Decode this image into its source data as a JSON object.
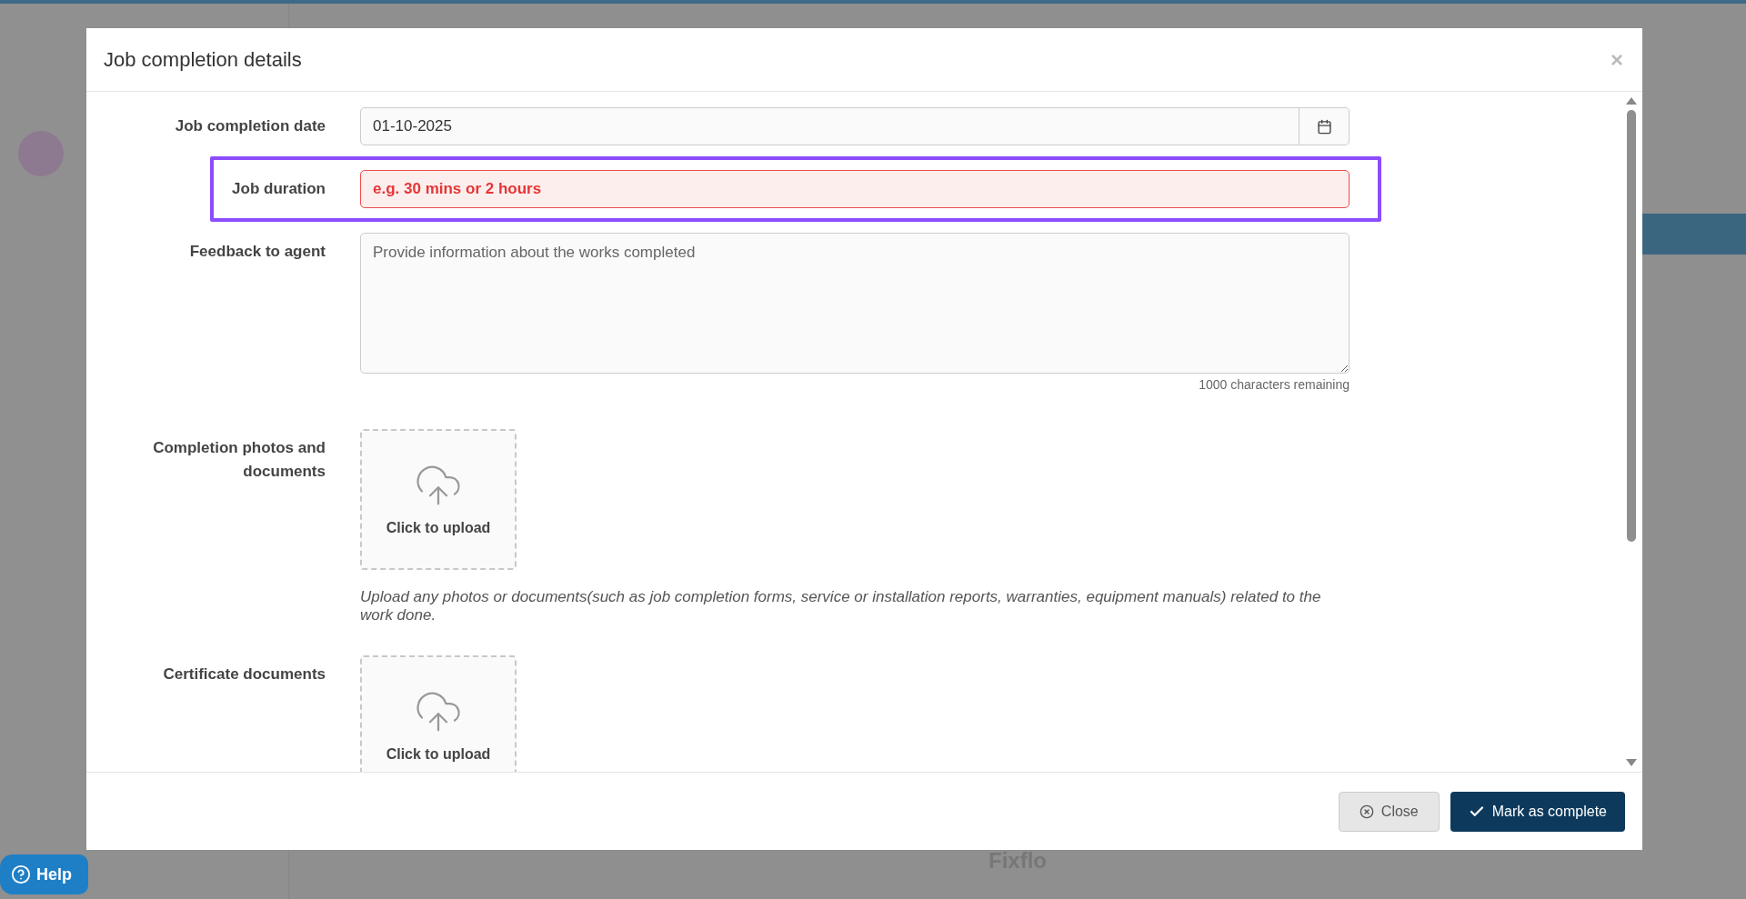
{
  "dialog": {
    "title": "Job completion details",
    "close_glyph": "×",
    "fields": [
      {
        "kind": "date",
        "label": "Job completion date",
        "value": "01-10-2025",
        "highlighted": false
      },
      {
        "kind": "text",
        "label": "Job duration",
        "placeholder": "e.g. 30 mins or 2 hours",
        "invalid": true,
        "highlighted": true
      },
      {
        "kind": "textarea",
        "label": "Feedback to agent",
        "placeholder": "Provide information about the works completed",
        "counter": "1000 characters remaining",
        "highlighted": false
      },
      {
        "kind": "upload",
        "label": "Completion photos and documents",
        "button": "Click to upload",
        "help": "Upload any photos or documents(such as job completion forms, service or installation reports, warranties, equipment manuals) related to the work done.",
        "highlighted": false
      },
      {
        "kind": "upload",
        "label": "Certificate documents",
        "button": "Click to upload",
        "highlighted": false
      }
    ],
    "buttons": [
      {
        "kind": "secondary",
        "label": "Close"
      },
      {
        "kind": "primary",
        "label": "Mark as complete"
      }
    ]
  },
  "footer_brand": "Fixflo",
  "help_button": "Help"
}
